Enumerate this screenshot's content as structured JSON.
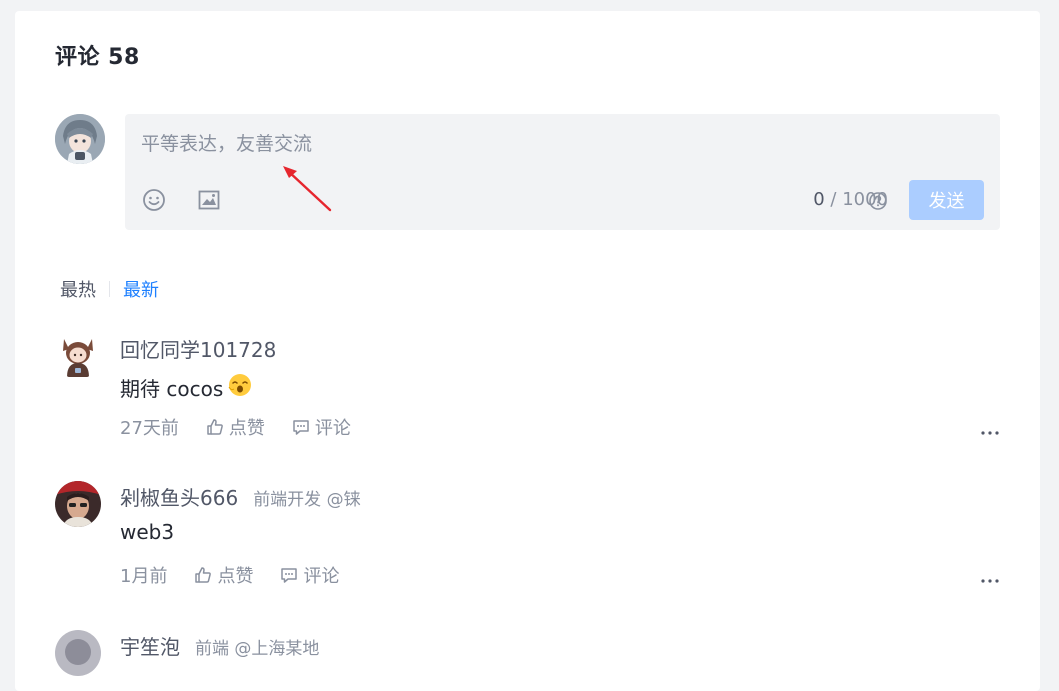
{
  "header": {
    "title": "评论 58"
  },
  "editor": {
    "placeholder": "平等表达，友善交流",
    "count_current": "0",
    "count_sep": " / ",
    "count_max": "1000",
    "send_label": "发送",
    "icons": [
      "emoji-icon",
      "image-icon",
      "help-icon"
    ]
  },
  "sort": {
    "hot_label": "最热",
    "new_label": "最新",
    "active": "new"
  },
  "comments": [
    {
      "name": "回忆同学101728",
      "job": "",
      "content": "期待 cocos",
      "emoji": "😮",
      "time": "27天前",
      "like_label": "点赞",
      "reply_label": "评论"
    },
    {
      "name": "剁椒鱼头666",
      "job": "前端开发 @铼",
      "content": "web3",
      "emoji": "",
      "time": "1月前",
      "like_label": "点赞",
      "reply_label": "评论"
    },
    {
      "name": "宇笙泡",
      "job": "前端 @上海某地",
      "content": "",
      "emoji": "",
      "time": "",
      "like_label": "",
      "reply_label": ""
    }
  ],
  "colors": {
    "accent": "#1e80ff",
    "send_disabled": "#abcdff",
    "annotation_arrow": "#e6262e"
  }
}
